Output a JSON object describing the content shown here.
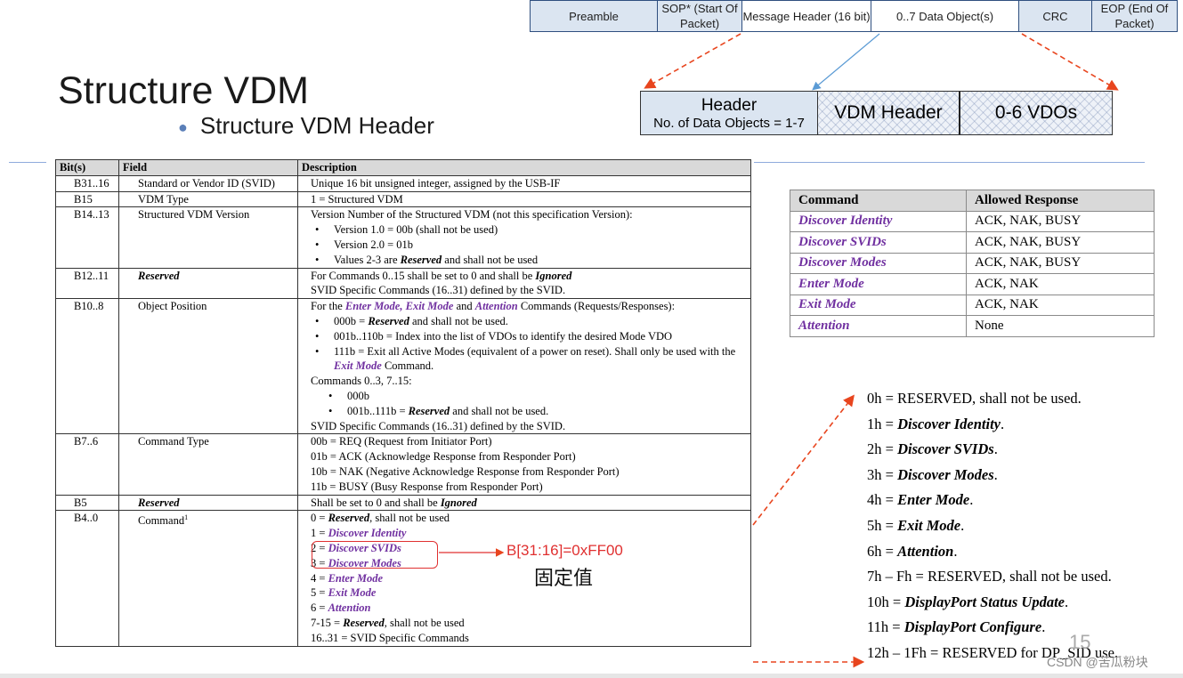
{
  "packet": [
    "Preamble",
    "SOP* (Start Of Packet)",
    "Message Header (16 bit)",
    "0..7 Data Object(s)",
    "CRC",
    "EOP (End Of Packet)"
  ],
  "header_bar": {
    "header_title": "Header",
    "header_sub": "No. of Data Objects = 1-7",
    "vdm_header": "VDM Header",
    "vdos": "0-6 VDOs"
  },
  "title": "Structure VDM",
  "subtitle": "Structure VDM Header",
  "table": {
    "headers": [
      "Bit(s)",
      "Field",
      "Description"
    ],
    "r1": {
      "bit": "B31..16",
      "field": "Standard or Vendor ID (SVID)",
      "desc": "Unique 16 bit unsigned integer, assigned by the USB-IF"
    },
    "r2": {
      "bit": "B15",
      "field": "VDM Type",
      "desc": "1 = Structured VDM"
    },
    "r3": {
      "bit": "B14..13",
      "field": "Structured VDM Version",
      "desc": "Version Number of the Structured VDM (not this specification Version):",
      "b1": "Version 1.0 = 00b (shall not be used)",
      "b2": "Version 2.0 = 01b",
      "b3a": "Values 2-3 are ",
      "b3b": "Reserved",
      "b3c": " and shall not be used"
    },
    "r4": {
      "bit": "B12..11",
      "field": "Reserved",
      "l1a": "For Commands 0..15 shall be set to 0 and shall be ",
      "l1b": "Ignored",
      "l2": "SVID Specific Commands (16..31) defined by the SVID."
    },
    "r5": {
      "bit": "B10..8",
      "field": "Object Position",
      "l1a": "For the ",
      "l1b": "Enter Mode, Exit Mode",
      "l1c": " and ",
      "l1d": "Attention",
      "l1e": " Commands (Requests/Responses):",
      "b1a": "000b = ",
      "b1b": "Reserved",
      "b1c": " and shall not be used.",
      "b2": "001b..110b = Index into the list of VDOs to identify the desired Mode VDO",
      "b3a": "111b = Exit all Active Modes (equivalent of a power on reset).  Shall only be used with the ",
      "b3b": "Exit Mode",
      "b3c": " Command.",
      "l2": "Commands 0..3, 7..15:",
      "d1": "000b",
      "d2a": "001b..111b = ",
      "d2b": "Reserved",
      "d2c": " and shall not be used.",
      "l3": "SVID Specific Commands (16..31) defined by the SVID."
    },
    "r6": {
      "bit": "B7..6",
      "field": "Command Type",
      "l1": "00b = REQ (Request from Initiator Port)",
      "l2": "01b = ACK (Acknowledge Response from Responder Port)",
      "l3": "10b = NAK (Negative Acknowledge Response from Responder Port)",
      "l4": "11b = BUSY (Busy Response from Responder Port)"
    },
    "r7": {
      "bit": "B5",
      "field": "Reserved",
      "da": "Shall be set to 0 and shall be ",
      "db": "Ignored"
    },
    "r8": {
      "bit": "B4..0",
      "field": "Command",
      "sup": "1",
      "c0a": "0 = ",
      "c0b": "Reserved",
      "c0c": ", shall not be used",
      "c1a": "1 = ",
      "c1b": "Discover Identity",
      "c2a": "2 = ",
      "c2b": "Discover SVIDs",
      "c3a": "3 = ",
      "c3b": "Discover Modes",
      "c4a": "4 = ",
      "c4b": "Enter Mode",
      "c5a": "5 = ",
      "c5b": "Exit Mode",
      "c6a": "6 = ",
      "c6b": "Attention",
      "c7a": "7-15 = ",
      "c7b": "Reserved",
      "c7c": ", shall not be used",
      "c8": "16..31 = SVID Specific Commands"
    }
  },
  "annotation": {
    "value": "B[31:16]=0xFF00",
    "note": "固定值"
  },
  "cmd_table": {
    "headers": [
      "Command",
      "Allowed Response"
    ],
    "rows": [
      {
        "cmd": "Discover Identity",
        "resp": "ACK, NAK, BUSY"
      },
      {
        "cmd": "Discover SVIDs",
        "resp": "ACK, NAK, BUSY"
      },
      {
        "cmd": "Discover Modes",
        "resp": "ACK, NAK, BUSY"
      },
      {
        "cmd": "Enter Mode",
        "resp": "ACK, NAK"
      },
      {
        "cmd": "Exit Mode",
        "resp": "ACK, NAK"
      },
      {
        "cmd": "Attention",
        "resp": "None"
      }
    ]
  },
  "codes": [
    {
      "a": "0h = RESERVED, shall not be used.",
      "b": "",
      "c": ""
    },
    {
      "a": "1h = ",
      "b": "Discover Identity",
      "c": "."
    },
    {
      "a": "2h = ",
      "b": "Discover SVIDs",
      "c": "."
    },
    {
      "a": "3h = ",
      "b": "Discover Modes",
      "c": "."
    },
    {
      "a": "4h = ",
      "b": "Enter Mode",
      "c": "."
    },
    {
      "a": "5h = ",
      "b": "Exit Mode",
      "c": "."
    },
    {
      "a": "6h = ",
      "b": "Attention",
      "c": "."
    },
    {
      "a": "7h – Fh = RESERVED, shall not be used.",
      "b": "",
      "c": ""
    },
    {
      "a": "10h = ",
      "b": "DisplayPort Status Update",
      "c": "."
    },
    {
      "a": "11h = ",
      "b": "DisplayPort Configure",
      "c": "."
    },
    {
      "a": "12h – 1Fh = RESERVED for DP_SID use.",
      "b": "",
      "c": ""
    }
  ],
  "page_number": "15",
  "watermark": "CSDN @苦瓜粉块",
  "colors": {
    "purple": "#7030a0",
    "red_annotation": "#e03030",
    "packet_fill": "#dbe5f1"
  }
}
